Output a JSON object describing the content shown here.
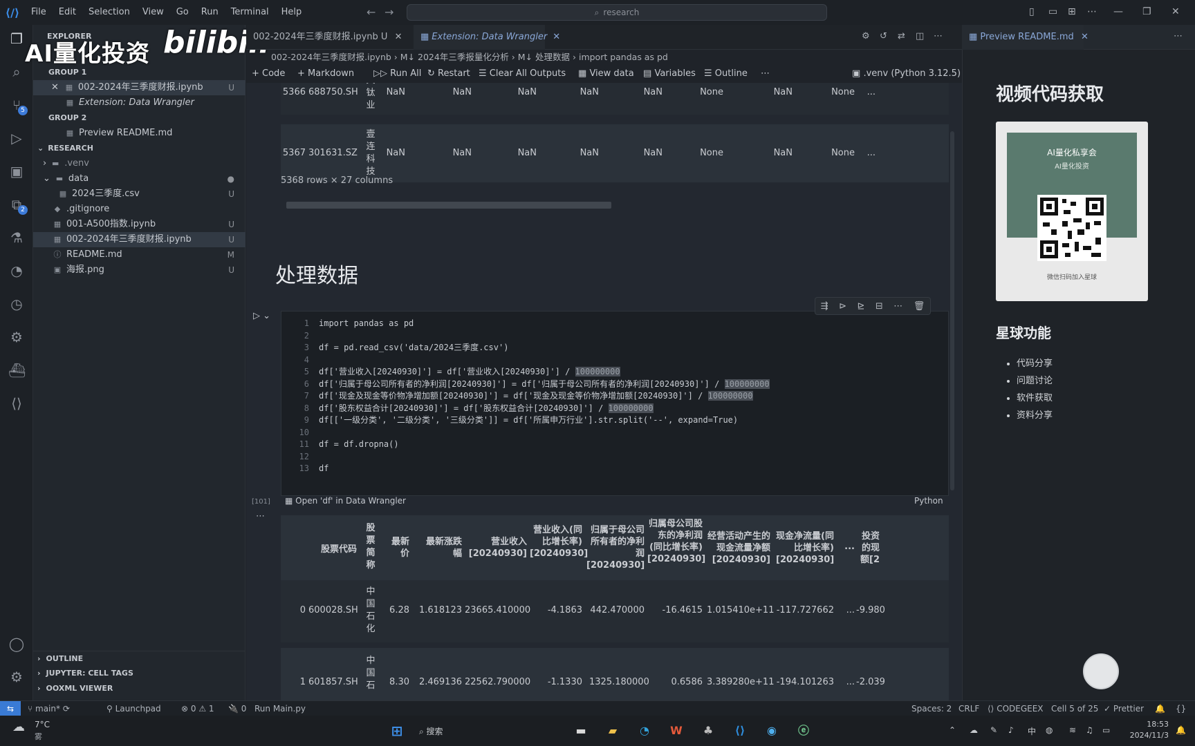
{
  "app": {
    "menu": [
      "File",
      "Edit",
      "Selection",
      "View",
      "Go",
      "Run",
      "Terminal",
      "Help"
    ],
    "search": "research"
  },
  "watermark": {
    "brand": "AI量化投资",
    "site": "bilibili"
  },
  "activity": {
    "icons": [
      "files-icon",
      "search-icon",
      "source-control-icon",
      "run-debug-icon",
      "remote-explorer-icon",
      "extensions-icon",
      "testing-icon",
      "git-graph-icon",
      "timeline-icon",
      "jupyter-icon",
      "docker-icon",
      "codegeex-icon"
    ],
    "scm_badge": "5",
    "ext_badge": "2"
  },
  "sidebar": {
    "title": "EXPLORER",
    "group1": "GROUP 1",
    "group1_items": [
      {
        "label": "002-2024年三季度财报.ipynb",
        "status": "U"
      },
      {
        "label": "Extension: Data Wrangler",
        "status": ""
      }
    ],
    "group2": "GROUP 2",
    "group2_items": [
      {
        "label": "Preview README.md"
      }
    ],
    "project": "RESEARCH",
    "files": [
      {
        "label": ".venv",
        "status": ""
      },
      {
        "label": "data",
        "status": "●"
      },
      {
        "label": "2024三季度.csv",
        "status": "U"
      },
      {
        "label": ".gitignore",
        "status": ""
      },
      {
        "label": "001-A500指数.ipynb",
        "status": "U"
      },
      {
        "label": "002-2024年三季度财报.ipynb",
        "status": "U"
      },
      {
        "label": "README.md",
        "status": "M"
      },
      {
        "label": "海报.png",
        "status": "U"
      }
    ],
    "bottom": [
      "OUTLINE",
      "JUPYTER: CELL TAGS",
      "OOXML VIEWER"
    ]
  },
  "tabs": [
    {
      "label": "002-2024年三季度财报.ipynb",
      "status": "U"
    },
    {
      "label": "Extension: Data Wrangler"
    }
  ],
  "breadcrumb": [
    "002-2024年三季度财报.ipynb",
    "M↓ 2024年三季报量化分析",
    "M↓ 处理数据",
    "import pandas as pd"
  ],
  "toolbar": {
    "code": "Code",
    "markdown": "Markdown",
    "run_all": "Run All",
    "restart": "Restart",
    "clear": "Clear All Outputs",
    "view_data": "View data",
    "variables": "Variables",
    "outline": "Outline",
    "kernel": ".venv (Python 3.12.5)"
  },
  "top_output": {
    "rows": [
      {
        "idx": "5366",
        "code": "688750.SH",
        "name": "天钛业",
        "vals": [
          "NaN",
          "NaN",
          "NaN",
          "NaN",
          "NaN",
          "None",
          "NaN",
          "None",
          "..."
        ]
      },
      {
        "idx": "5367",
        "code": "301631.SZ",
        "name": "壹连科技",
        "vals": [
          "NaN",
          "NaN",
          "NaN",
          "NaN",
          "NaN",
          "None",
          "NaN",
          "None",
          "..."
        ]
      }
    ],
    "summary": "5368 rows × 27 columns"
  },
  "heading": "处理数据",
  "code_cell": {
    "exec_count": "[101]",
    "lines": [
      "import pandas as pd",
      "",
      "df = pd.read_csv('data/2024三季度.csv')",
      "",
      "df['营业收入[20240930]'] = df['营业收入[20240930]'] / ",
      "df['归属于母公司所有者的净利润[20240930]'] = df['归属于母公司所有者的净利润[20240930]'] / ",
      "df['现金及现金等价物净增加额[20240930]'] = df['现金及现金等价物净增加额[20240930]'] / ",
      "df['股东权益合计[20240930]'] = df['股东权益合计[20240930]'] / ",
      "df[['一级分类', '二级分类', '三级分类']] = df['所属申万行业'].str.split('--', expand=True)",
      "",
      "df = df.dropna()",
      "",
      "df"
    ],
    "divisor": "100000000",
    "footer_left": "Open 'df' in Data Wrangler",
    "footer_right": "Python"
  },
  "output_table": {
    "headers": [
      "股票代码",
      "股票简称",
      "最新价",
      "最新涨跌幅",
      "营业收入[20240930]",
      "营业收入(同比增长率)[20240930]",
      "归属于母公司所有者的净利润[20240930]",
      "归属母公司股东的净利润(同比增长率)[20240930]",
      "经营活动产生的现金流量净额[20240930]",
      "现金净流量(同比增长率)[20240930]",
      "...",
      "投资的现额[2"
    ],
    "rows": [
      {
        "idx": "0",
        "code": "600028.SH",
        "name": "中国石化",
        "vals": [
          "6.28",
          "1.618123",
          "23665.410000",
          "-4.1863",
          "442.470000",
          "-16.4615",
          "1.015410e+11",
          "-117.727662",
          "...",
          "-9.980"
        ]
      },
      {
        "idx": "1",
        "code": "601857.SH",
        "name": "中国石",
        "vals": [
          "8.30",
          "2.469136",
          "22562.790000",
          "-1.1330",
          "1325.180000",
          "0.6586",
          "3.389280e+11",
          "-194.101263",
          "...",
          "-2.039"
        ]
      }
    ]
  },
  "preview": {
    "tab": "Preview README.md",
    "title": "视频代码获取",
    "qr_header": "AI量化私享会",
    "qr_sub": "AI量化投资",
    "qr_caption": "微信扫码加入星球",
    "features_title": "星球功能",
    "features": [
      "代码分享",
      "问题讨论",
      "软件获取",
      "资料分享"
    ]
  },
  "status": {
    "branch": "main*",
    "launchpad": "Launchpad",
    "problems": "⊗ 0 ⚠ 1",
    "ports": "🔌 0",
    "run": "Run Main.py",
    "spaces": "Spaces: 2",
    "eol": "CRLF",
    "codegeex": "CODEGEEX",
    "cell": "Cell 5 of 25",
    "prettier": "✓ Prettier"
  },
  "taskbar": {
    "weather": "7°C",
    "weather_sub": "雾",
    "search": "搜索",
    "ime": "中",
    "time": "18:53",
    "date": "2024/11/3"
  }
}
